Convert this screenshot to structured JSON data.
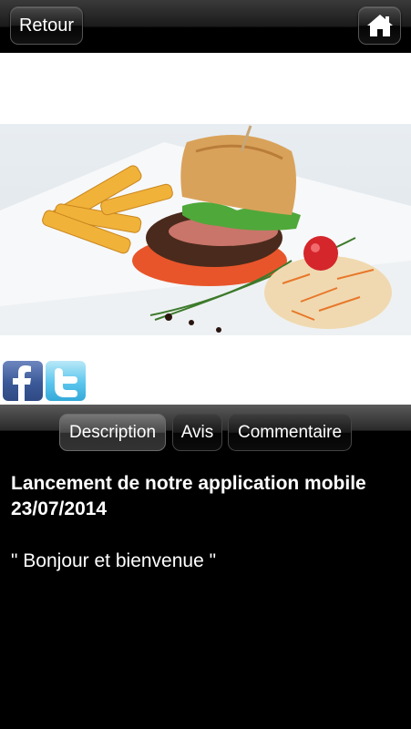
{
  "header": {
    "back_label": "Retour",
    "home_icon": "home-icon"
  },
  "social": {
    "facebook_icon": "facebook-icon",
    "twitter_icon": "twitter-icon"
  },
  "tabs": [
    {
      "label": "Description",
      "active": true
    },
    {
      "label": "Avis",
      "active": false
    },
    {
      "label": "Commentaire",
      "active": false
    }
  ],
  "content": {
    "title_line1": "Lancement de notre application mobile",
    "title_line2": "23/07/2014",
    "body": "\" Bonjour et bienvenue \""
  },
  "colors": {
    "background": "#000000",
    "facebook": "#3b5998",
    "twitter": "#5bc6ee"
  }
}
